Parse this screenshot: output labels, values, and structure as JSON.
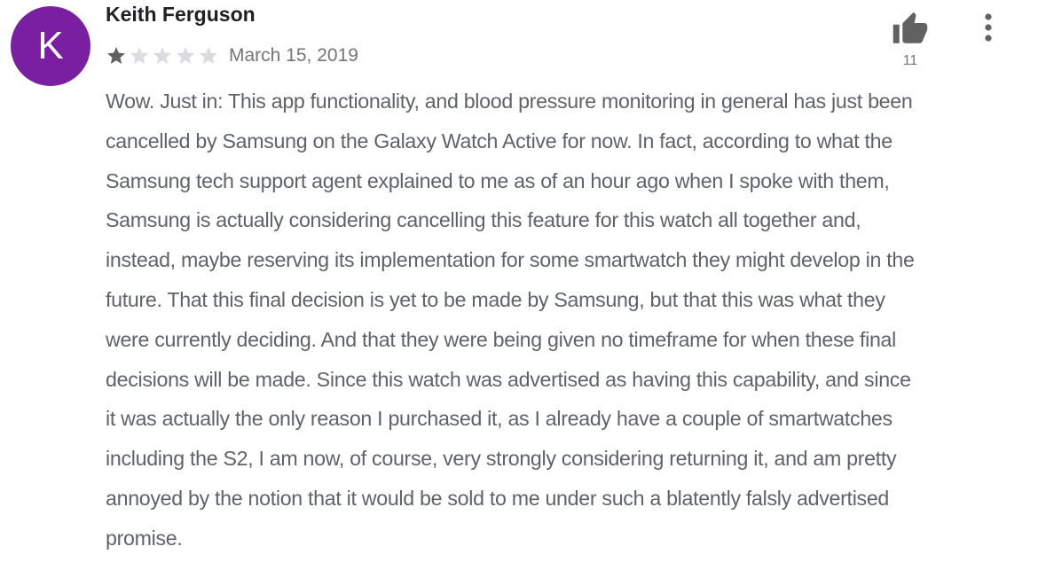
{
  "review": {
    "avatar_initial": "K",
    "avatar_color": "#7b1fa2",
    "author": "Keith Ferguson",
    "rating": 1,
    "rating_max": 5,
    "date": "March 15, 2019",
    "helpful_count": "11",
    "body_lines": [
      "Wow. Just in: This app functionality, and blood pressure monitoring in general has just been",
      "cancelled by Samsung on the Galaxy Watch Active for now. In fact, according to what the",
      "Samsung tech support agent explained to me as of an hour ago when I spoke with them,",
      "Samsung is actually considering cancelling this feature for this watch all together and,",
      "instead, maybe reserving its implementation for some smartwatch they might develop in the",
      "future. That this final decision is yet to be made by Samsung, but that this was what they",
      "were currently deciding. And that they were being given no timeframe for when these final",
      "decisions will be made. Since this watch was advertised as having this capability, and since",
      "it was actually the only reason I purchased it, as I already have a couple of smartwatches",
      "including the S2, I am now, of course, very strongly considering returning it, and am pretty",
      "annoyed by the notion that it would be sold to me under such a blatently falsly advertised",
      "promise."
    ]
  },
  "icons": {
    "helpful": "thumbs-up-icon",
    "more": "more-vert-icon",
    "star_filled": "star-filled-icon",
    "star_empty": "star-empty-icon"
  },
  "colors": {
    "star_filled": "#616161",
    "star_empty": "#dadce0",
    "icon": "#616161"
  }
}
